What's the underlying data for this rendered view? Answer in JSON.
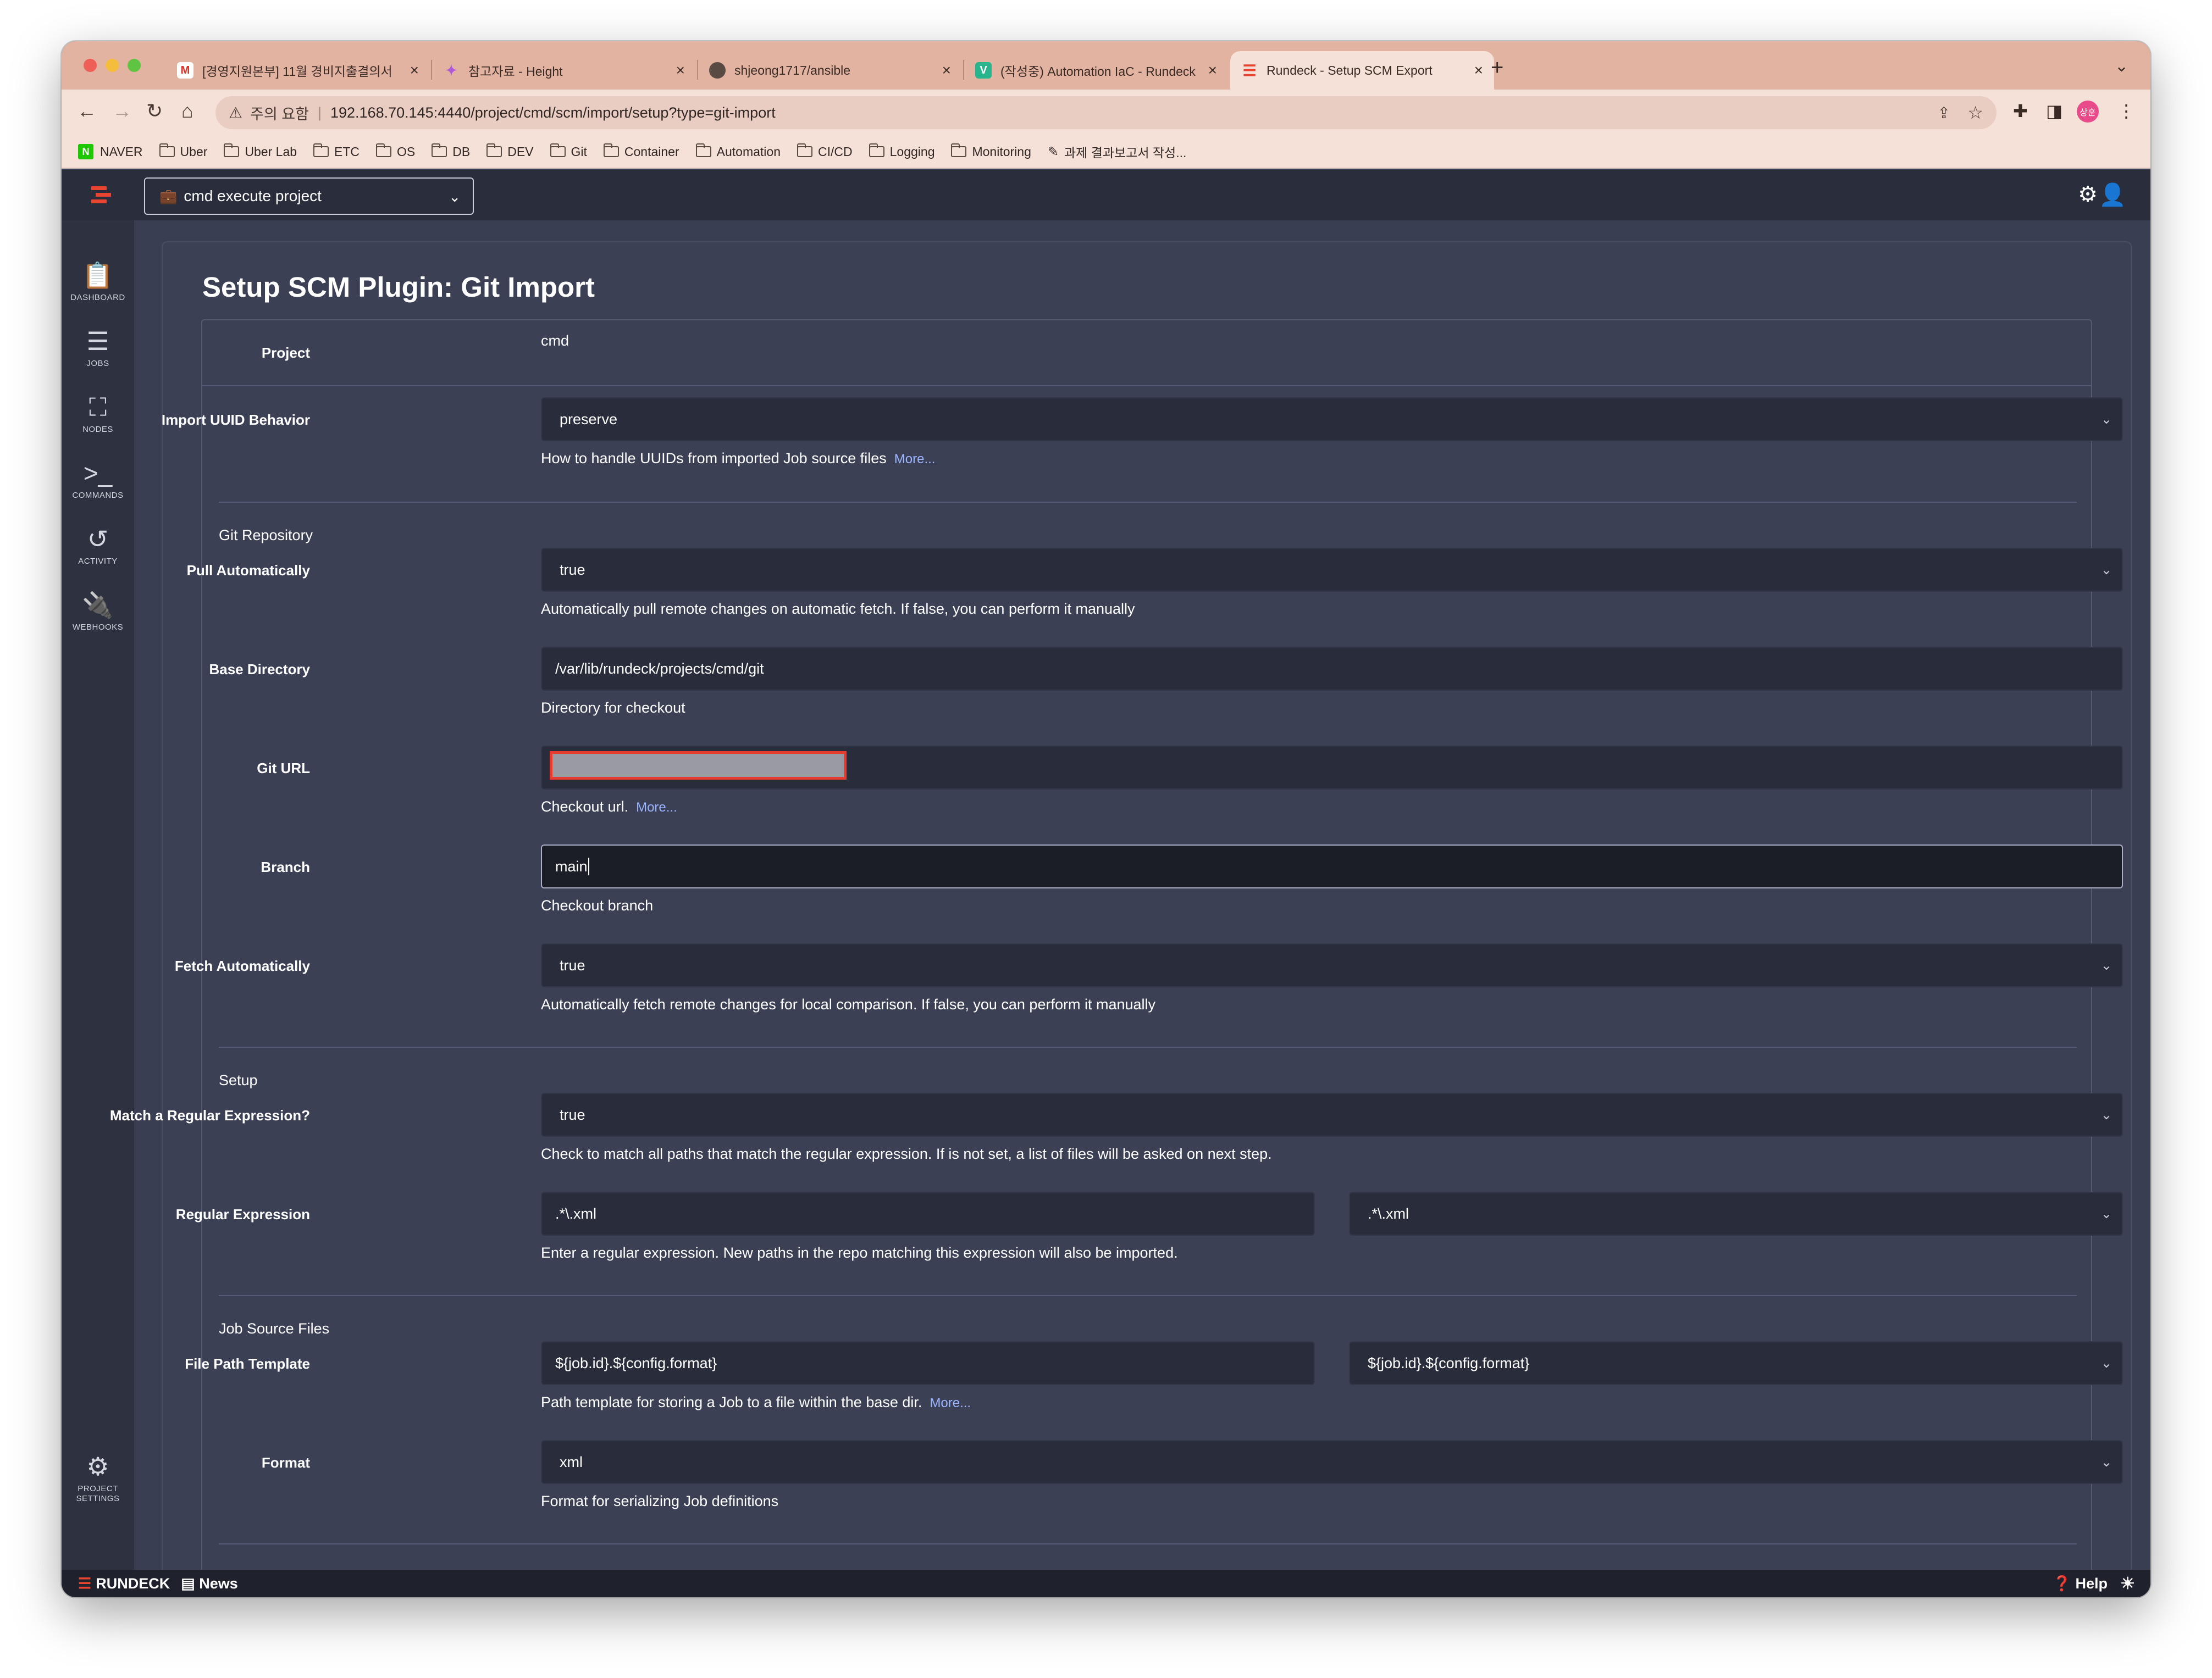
{
  "browser": {
    "tabs": [
      {
        "title": "[경영지원본부] 11월 경비지출결의서",
        "icon": "gmail-icon"
      },
      {
        "title": "참고자료 - Height",
        "icon": "height-icon"
      },
      {
        "title": "shjeong1717/ansible",
        "icon": "github-icon"
      },
      {
        "title": "(작성중) Automation IaC - Rundeck",
        "icon": "v-icon"
      },
      {
        "title": "Rundeck - Setup SCM Export",
        "icon": "rundeck-icon"
      }
    ],
    "address": {
      "warning": "주의 요함",
      "url": "192.168.70.145:4440/project/cmd/scm/import/setup?type=git-import"
    },
    "profile": "상훈",
    "bookmarks": [
      "NAVER",
      "Uber",
      "Uber Lab",
      "ETC",
      "OS",
      "DB",
      "DEV",
      "Git",
      "Container",
      "Automation",
      "CI/CD",
      "Logging",
      "Monitoring",
      "과제 결과보고서 작성..."
    ]
  },
  "app": {
    "project_selector": "cmd execute project",
    "sidebar": [
      {
        "label": "DASHBOARD",
        "icon": "clipboard-icon"
      },
      {
        "label": "JOBS",
        "icon": "list-icon"
      },
      {
        "label": "NODES",
        "icon": "sitemap-icon"
      },
      {
        "label": "COMMANDS",
        "icon": "terminal-icon"
      },
      {
        "label": "ACTIVITY",
        "icon": "history-icon"
      },
      {
        "label": "WEBHOOKS",
        "icon": "plug-icon"
      }
    ],
    "project_settings": [
      "PROJECT",
      "SETTINGS"
    ],
    "footer": {
      "brand": "RUNDECK",
      "news": "News",
      "help": "Help"
    }
  },
  "page": {
    "title": "Setup SCM Plugin: Git Import",
    "more": "More...",
    "project": {
      "label": "Project",
      "value": "cmd"
    },
    "import_uuid": {
      "label": "Import UUID Behavior",
      "value": "preserve",
      "help": "How to handle UUIDs from imported Job source files"
    },
    "git_repository": {
      "section": "Git Repository",
      "pull": {
        "label": "Pull Automatically",
        "value": "true",
        "help": "Automatically pull remote changes on automatic fetch. If false, you can perform it manually"
      },
      "base_dir": {
        "label": "Base Directory",
        "value": "/var/lib/rundeck/projects/cmd/git",
        "help": "Directory for checkout"
      },
      "git_url": {
        "label": "Git URL",
        "value": "",
        "help": "Checkout url."
      },
      "branch": {
        "label": "Branch",
        "value": "main",
        "help": "Checkout branch"
      },
      "fetch": {
        "label": "Fetch Automatically",
        "value": "true",
        "help": "Automatically fetch remote changes for local comparison. If false, you can perform it manually"
      }
    },
    "setup": {
      "section": "Setup",
      "match_regex": {
        "label": "Match a Regular Expression?",
        "value": "true",
        "help": "Check to match all paths that match the regular expression. If is not set, a list of files will be asked on next step."
      },
      "regex": {
        "label": "Regular Expression",
        "value": ".*\\.xml",
        "option": ".*\\.xml",
        "help": "Enter a regular expression. New paths in the repo matching this expression will also be imported."
      }
    },
    "job_source": {
      "section": "Job Source Files",
      "path_template": {
        "label": "File Path Template",
        "value": "${job.id}.${config.format}",
        "option": "${job.id}.${config.format}",
        "help": "Path template for storing a Job to a file within the base dir."
      },
      "format": {
        "label": "Format",
        "value": "xml",
        "help": "Format for serializing Job definitions"
      }
    }
  }
}
